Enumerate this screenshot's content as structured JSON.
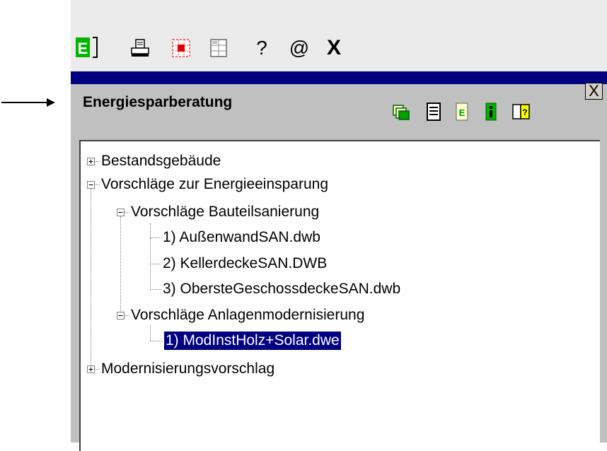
{
  "toolbar": {
    "icons": [
      "energy-document-icon",
      "print-icon",
      "grid-icon",
      "table-icon",
      "help-icon",
      "email-icon",
      "exit-icon"
    ],
    "help_label": "?",
    "email_label": "@",
    "exit_label": "X"
  },
  "panel": {
    "title": "Energiesparberatung",
    "close_label": "X",
    "icons": [
      "copy-icon",
      "list-icon",
      "document-icon",
      "info-icon",
      "book-icon"
    ]
  },
  "tree": {
    "n0": "Bestandsgebäude",
    "n1": "Vorschläge zur Energieeinsparung",
    "n2": "Vorschläge Bauteilsanierung",
    "n3": "1) AußenwandSAN.dwb",
    "n4": "2) KellerdeckeSAN.DWB",
    "n5": "3) ObersteGeschossdeckeSAN.dwb",
    "n6": "Vorschläge Anlagenmodernisierung",
    "n7": "1) ModInstHolz+Solar.dwe",
    "n8": "Modernisierungsvorschlag"
  },
  "colors": {
    "title_bar": "#000080",
    "selection": "#000080",
    "panel_bg": "#c0c0c0",
    "toolbar_bg": "#ebebeb"
  }
}
